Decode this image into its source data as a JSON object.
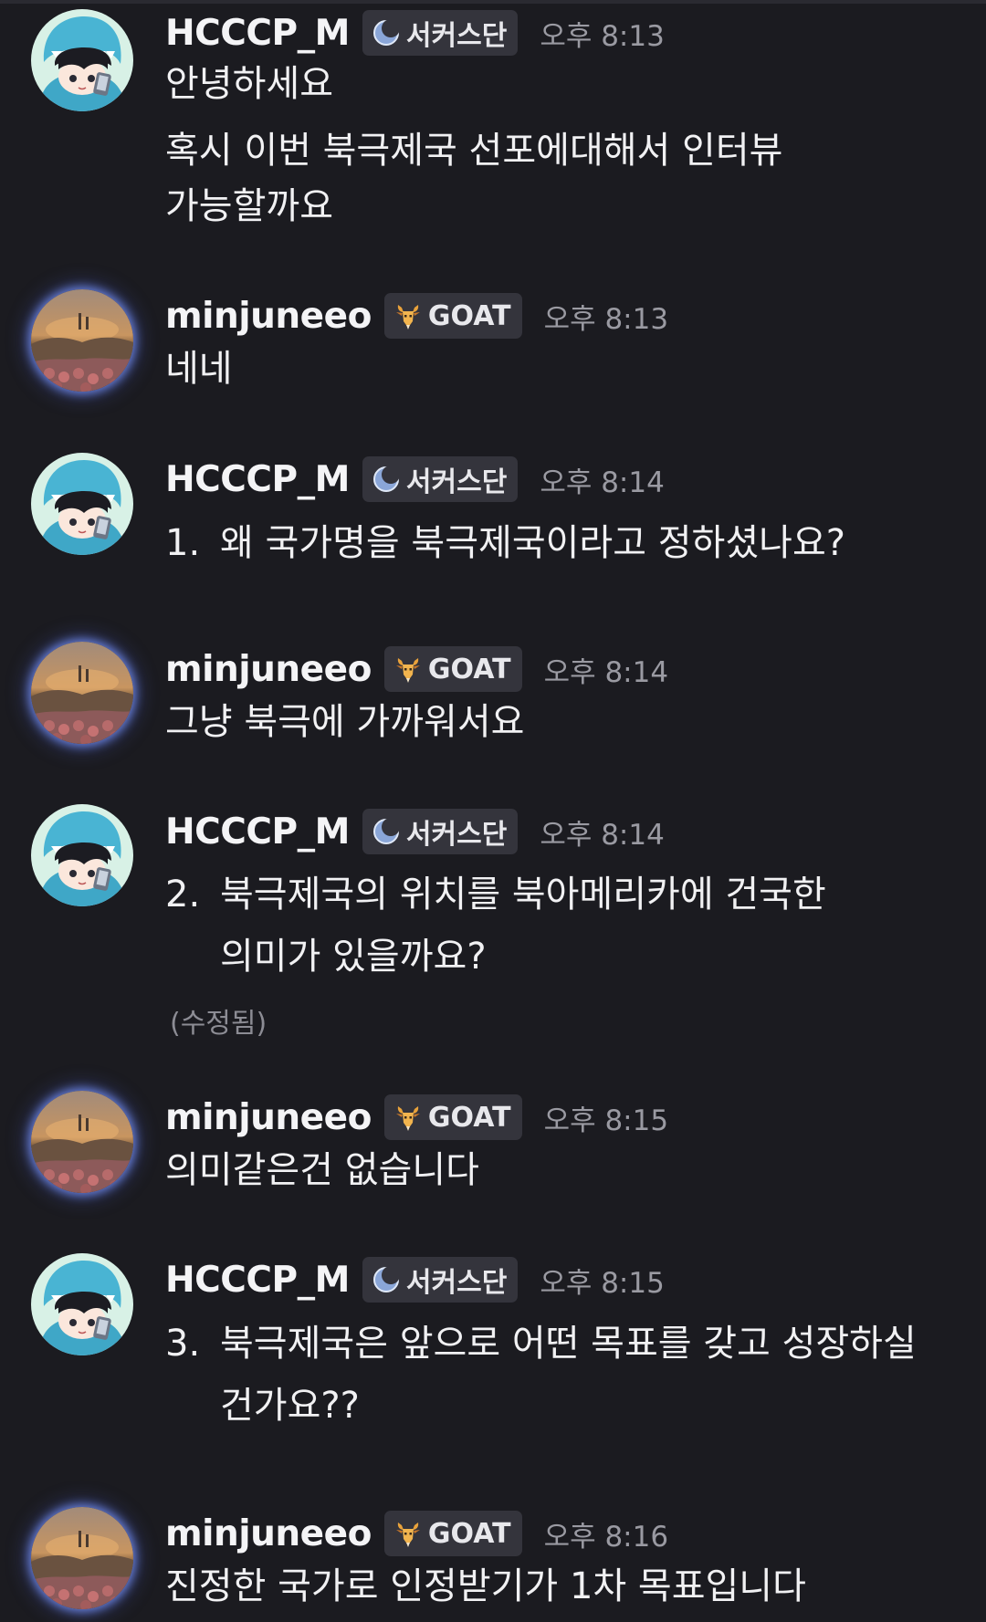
{
  "users": {
    "hcccp": {
      "name": "HCCCP_M",
      "badge": "서커스단",
      "badge_icon": "crescent-moon-icon"
    },
    "minjun": {
      "name": "minjuneeo",
      "badge": "GOAT",
      "badge_icon": "goat-head-icon"
    }
  },
  "messages": [
    {
      "user": "HCCCP_M",
      "badge": "서커스단",
      "time": "오후 8:13",
      "lines": [
        "안녕하세요",
        "혹시 이번 북극제국 선포에대해서 인터뷰",
        "가능할까요"
      ]
    },
    {
      "user": "minjuneeo",
      "badge": "GOAT",
      "time": "오후 8:13",
      "lines": [
        "네네"
      ]
    },
    {
      "user": "HCCCP_M",
      "badge": "서커스단",
      "time": "오후 8:14",
      "num": "1.",
      "lines": [
        "왜 국가명을 북극제국이라고 정하셨나요?"
      ]
    },
    {
      "user": "minjuneeo",
      "badge": "GOAT",
      "time": "오후 8:14",
      "lines": [
        "그냥 북극에 가까워서요"
      ]
    },
    {
      "user": "HCCCP_M",
      "badge": "서커스단",
      "time": "오후 8:14",
      "num": "2.",
      "lines": [
        "북극제국의 위치를 북아메리카에 건국한",
        "의미가 있을까요?"
      ],
      "edited": "(수정됨)"
    },
    {
      "user": "minjuneeo",
      "badge": "GOAT",
      "time": "오후 8:15",
      "lines": [
        "의미같은건 없습니다"
      ]
    },
    {
      "user": "HCCCP_M",
      "badge": "서커스단",
      "time": "오후 8:15",
      "num": "3.",
      "lines": [
        "북극제국은 앞으로 어떤 목표를 갖고 성장하실",
        "건가요??"
      ]
    },
    {
      "user": "minjuneeo",
      "badge": "GOAT",
      "time": "오후 8:16",
      "lines": [
        "진정한 국가로 인정받기가 1차 목표입니다"
      ]
    }
  ]
}
